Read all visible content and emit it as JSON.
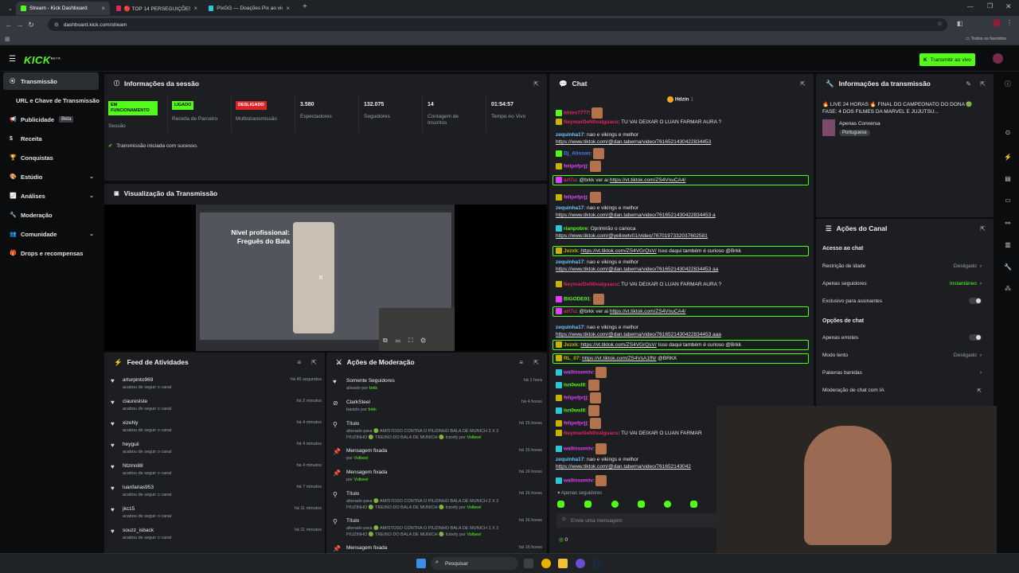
{
  "browser": {
    "tabs": [
      {
        "title": "Stream - Kick Dashboard",
        "active": true,
        "favicon_color": "#53fc18"
      },
      {
        "title": "🔴 TOP 14 PERSEGUIÇÕES DE 1",
        "active": false,
        "favicon_color": "#e0245e"
      },
      {
        "title": "PixGG — Doações Pix ao vivo p",
        "active": false,
        "favicon_color": "#2ec7d6"
      }
    ],
    "url": "dashboard.kick.com/stream",
    "bookmarks_label": "Todos os favoritos"
  },
  "app": {
    "logo": "KICK",
    "logo_beta": "BETA",
    "go_live_label": "Transmitir ao vivo",
    "brand_color": "#53fc18"
  },
  "sidebar": {
    "items": [
      {
        "label": "Transmissão",
        "icon": "broadcast-icon",
        "active": true
      },
      {
        "label": "URL e Chave de Transmissão",
        "icon": "",
        "active": false
      },
      {
        "label": "Publicidade",
        "icon": "megaphone-icon",
        "badge": "Beta"
      },
      {
        "label": "Receita",
        "icon": "dollar-icon"
      },
      {
        "label": "Conquistas",
        "icon": "trophy-icon"
      },
      {
        "label": "Estúdio",
        "icon": "palette-icon",
        "chevron": true
      },
      {
        "label": "Análises",
        "icon": "chart-icon",
        "chevron": true
      },
      {
        "label": "Moderação",
        "icon": "wrench-icon"
      },
      {
        "label": "Comunidade",
        "icon": "people-icon",
        "chevron": true
      },
      {
        "label": "Drops e recompensas",
        "icon": "gift-icon"
      }
    ]
  },
  "session": {
    "title": "Informações da sessão",
    "stats": [
      {
        "badge": "EM FUNCIONAMENTO",
        "badge_color": "#53fc18",
        "label": "Sessão"
      },
      {
        "badge": "LIGADO",
        "badge_color": "#53fc18",
        "label": "Receita de Parceiro"
      },
      {
        "badge": "DESLIGADO",
        "badge_color": "#e02424",
        "label": "Multistransmissão"
      },
      {
        "value": "3.580",
        "label": "Espectadores"
      },
      {
        "value": "132.075",
        "label": "Seguidores"
      },
      {
        "value": "14",
        "label": "Contagem de Inscritos"
      },
      {
        "value": "01:54:57",
        "label": "Tempo Ao Vivo"
      }
    ],
    "success_message": "Transmissão iniciada com sucesso."
  },
  "preview": {
    "title": "Visualização da Transmissão",
    "video_caption_line1": "Nível profissional:",
    "video_caption_line2": "Freguês do Bala"
  },
  "feed": {
    "title": "Feed de Atividades",
    "items": [
      {
        "user": "arturpinto969",
        "desc": "acabou de seguir o canal",
        "time": "há 45 segundos"
      },
      {
        "user": "claureslste",
        "desc": "acabou de seguir o canal",
        "time": "há 2 minutos"
      },
      {
        "user": "xizeNy",
        "desc": "acabou de seguir o canal",
        "time": "há 4 minutos"
      },
      {
        "user": "heyguii",
        "desc": "acabou de seguir o canal",
        "time": "há 4 minutos"
      },
      {
        "user": "Ntzinn88",
        "desc": "acabou de seguir o canal",
        "time": "há 4 minutos"
      },
      {
        "user": "luanfarias953",
        "desc": "acabou de seguir o canal",
        "time": "há 7 minutos"
      },
      {
        "user": "jkc15",
        "desc": "acabou de seguir o canal",
        "time": "há 11 minutos"
      },
      {
        "user": "souzz_isback",
        "desc": "acabou de seguir o canal",
        "time": "há 11 minutos"
      }
    ]
  },
  "modactions": {
    "title": "Ações de Moderação",
    "items": [
      {
        "icon": "heart-icon",
        "title": "Somente Seguidores",
        "desc": "ativado por ",
        "by": "brkk",
        "time": "há 1 hora"
      },
      {
        "icon": "ban-icon",
        "title": "ClarkSteel",
        "desc": "banido por ",
        "by": "brkk",
        "time": "há 4 horas"
      },
      {
        "icon": "title-icon",
        "title": "Título",
        "desc": "alterado para 🟢 AMISTOSO CONTRA O PIUZINHO BALA DE MUNICH 3 X 2 PIUZINHO 🟢 TREINO DO BALA DE MUNICH 🟢 Icinefy por ",
        "by": "Volbeel",
        "time": "há 15 horas"
      },
      {
        "icon": "pin-icon",
        "title": "Mensagem fixada",
        "desc": "por ",
        "by": "Volbeel",
        "time": "há 15 horas"
      },
      {
        "icon": "pin-icon",
        "title": "Mensagem fixada",
        "desc": "por ",
        "by": "Volbeel",
        "time": "há 16 horas"
      },
      {
        "icon": "title-icon",
        "title": "Título",
        "desc": "alterado para 🟢 AMISTOSO CONTRA O PIUZINHO BALA DE MUNICH 2 X 2 PIUZINHO 🟢 TREINO DO BALA DE MUNICH 🟢 Icinefy por ",
        "by": "Volbeel",
        "time": "há 16 horas"
      },
      {
        "icon": "title-icon",
        "title": "Título",
        "desc": "alterado para 🟢 AMISTOSO CONTRA O PIUZINHO BALA DE MUNICH 1 X 2 PIUZINHO 🟢 TREINO DO BALA DE MUNICH 🟢 Icinefy por ",
        "by": "Volbeel",
        "time": "há 16 horas"
      },
      {
        "icon": "pin-icon",
        "title": "Mensagem fixada",
        "desc": "",
        "by": "",
        "time": "há 16 horas"
      }
    ]
  },
  "chat": {
    "title": "Chat",
    "pinned_user": "Hdzin",
    "pinned_count": "1",
    "messages": [
      {
        "name": "bkteo7777",
        "color": "#e0245e",
        "badge": "#53fc18",
        "text": "",
        "link": "",
        "emote": true,
        "highlight": false
      },
      {
        "name": "NeymarDeN0valguacu",
        "color": "#e0245e",
        "badge": "#c8b400",
        "text": "TU VAI DEIXAR O LUAN FARMAR AURA ?",
        "link": "",
        "highlight": false
      },
      {
        "name": "zequinha17",
        "color": "#6ec6ff",
        "badge": "",
        "text": "nao e vikings e melhor",
        "link": "https://www.tiktok.com/@dan.taberna/video/7616521430422834453",
        "highlight": false
      },
      {
        "name": "Dj_Alisson",
        "color": "#4d7cff",
        "badge": "#53fc18",
        "text": "",
        "link": "",
        "emote": true,
        "highlight": false
      },
      {
        "name": "felipefprjj",
        "color": "#e040fb",
        "badge": "#c8b400",
        "text": "",
        "link": "",
        "emote": true,
        "highlight": false
      },
      {
        "name": "art7u",
        "color": "#e0245e",
        "badge": "#e040fb",
        "text": "@brkk ver ai ",
        "link": "https://vt.tiktok.com/ZS4VnuCA4/",
        "highlight": true
      },
      {
        "name": "felipefprjj",
        "color": "#e040fb",
        "badge": "#c8b400",
        "text": "",
        "link": "",
        "emote": true,
        "highlight": false
      },
      {
        "name": "zequinha17",
        "color": "#6ec6ff",
        "badge": "",
        "text": "nao e vikings e melhor",
        "link": "https://www.tiktok.com/@dan.taberna/video/7616521430422834453 a",
        "highlight": false
      },
      {
        "name": "rianpobre",
        "color": "#53fc18",
        "badge": "#2ec7d6",
        "text": "Oprimirão o carioca",
        "link": "https://www.tiktok.com/@yellowtv01/video/7670197332037602581",
        "highlight": false
      },
      {
        "name": "Jvzxk",
        "color": "#c8b400",
        "badge": "#c8b400",
        "text": "",
        "link": "https://vt.tiktok.com/ZS4VGrQsV/",
        "after": " Isso daqui também é curioso @Brkk",
        "highlight": true
      },
      {
        "name": "zequinha17",
        "color": "#6ec6ff",
        "badge": "",
        "text": "nao e vikings e melhor",
        "link": "https://www.tiktok.com/@dan.taberna/video/7616521430422834453 aa",
        "highlight": false
      },
      {
        "name": "NeymarDeN0valguacu",
        "color": "#e0245e",
        "badge": "#c8b400",
        "text": "TU VAI DEIXAR O LUAN FARMAR AURA ?",
        "link": "",
        "highlight": false
      },
      {
        "name": "BIGODE01",
        "color": "#53fc18",
        "badge": "#e040fb",
        "text": "",
        "link": "",
        "emote": true,
        "highlight": false
      },
      {
        "name": "art7u",
        "color": "#e0245e",
        "badge": "#e040fb",
        "text": "@brkk ver ai ",
        "link": "https://vt.tiktok.com/ZS4VnuCA4/",
        "highlight": true
      },
      {
        "name": "zequinha17",
        "color": "#6ec6ff",
        "badge": "",
        "text": "nao e vikings e melhor",
        "link": "https://www.tiktok.com/@dan.taberna/video/7616521430422834453 aaa",
        "highlight": false
      },
      {
        "name": "Jvzxk",
        "color": "#c8b400",
        "badge": "#c8b400",
        "text": "",
        "link": "https://vt.tiktok.com/ZS4VGrQsV/",
        "after": " Isso daqui também é curioso @Brkk",
        "highlight": true
      },
      {
        "name": "RL_07",
        "color": "#c8b400",
        "badge": "#c8b400",
        "text": "",
        "link": "https://vt.tiktok.com/ZS4VsA1fN/",
        "after": " @BRKK",
        "highlight": true
      },
      {
        "name": "wallissomtv",
        "color": "#e040fb",
        "badge": "#2ec7d6",
        "text": "",
        "link": "",
        "emote": true,
        "highlight": false
      },
      {
        "name": "isn0wxlll",
        "color": "#53fc18",
        "badge": "#2ec7d6",
        "text": "",
        "link": "",
        "emote": true,
        "highlight": false
      },
      {
        "name": "felipefprjj",
        "color": "#e040fb",
        "badge": "#c8b400",
        "text": "",
        "link": "",
        "emote": true,
        "highlight": false
      },
      {
        "name": "isn0wxlll",
        "color": "#53fc18",
        "badge": "#2ec7d6",
        "text": "",
        "link": "",
        "emote": true,
        "highlight": false
      },
      {
        "name": "felipefprjj",
        "color": "#e040fb",
        "badge": "#c8b400",
        "text": "",
        "link": "",
        "emote": true,
        "highlight": false
      },
      {
        "name": "NeymarDeN0valguacu",
        "color": "#e0245e",
        "badge": "#c8b400",
        "text": "TU VAI DEIXAR O LUAN FARMAR",
        "link": "",
        "highlight": false
      },
      {
        "name": "wallissomtv",
        "color": "#e040fb",
        "badge": "#2ec7d6",
        "text": "",
        "link": "",
        "emote": true,
        "highlight": false
      },
      {
        "name": "zequinha17",
        "color": "#6ec6ff",
        "badge": "",
        "text": "nao e vikings e melhor",
        "link": "https://www.tiktok.com/@dan.taberna/video/761652143042",
        "highlight": false
      },
      {
        "name": "wallissomtv",
        "color": "#e040fb",
        "badge": "#2ec7d6",
        "text": "",
        "link": "",
        "emote": true,
        "highlight": false
      }
    ],
    "followers_only_label": "Apenas seguidores",
    "input_placeholder": "Envie uma mensagem",
    "points": "0"
  },
  "stream_info": {
    "title": "Informações da transmissão",
    "stream_title": "🔥 LIVE 24 HORAS 🔥 FINAL DO CAMPEONATO DO DONA 🟢 FASE: 4 DOS FILMES DA MARVEL E JUJUTSU...",
    "category": "Apenas Conversa",
    "language": "Portuguese"
  },
  "channel_actions": {
    "title": "Ações do Canal",
    "chat_access_heading": "Acesso ao chat",
    "chat_access": [
      {
        "label": "Restrição de idade",
        "value": "Desligado",
        "type": "select"
      },
      {
        "label": "Apenas seguidores",
        "value": "Instantâneo",
        "type": "select",
        "value_color": "#53fc18"
      },
      {
        "label": "Exclusivo para assinantes",
        "value": "",
        "type": "toggle"
      }
    ],
    "chat_options_heading": "Opções de chat",
    "chat_options": [
      {
        "label": "Apenas emotes",
        "value": "",
        "type": "toggle"
      },
      {
        "label": "Modo lento",
        "value": "Desligado",
        "type": "select"
      },
      {
        "label": "Palavras banidas",
        "value": "",
        "type": "select"
      },
      {
        "label": "Moderação de chat com IA",
        "value": "",
        "type": "external"
      }
    ]
  },
  "taskbar": {
    "search_label": "Pesquisar"
  }
}
